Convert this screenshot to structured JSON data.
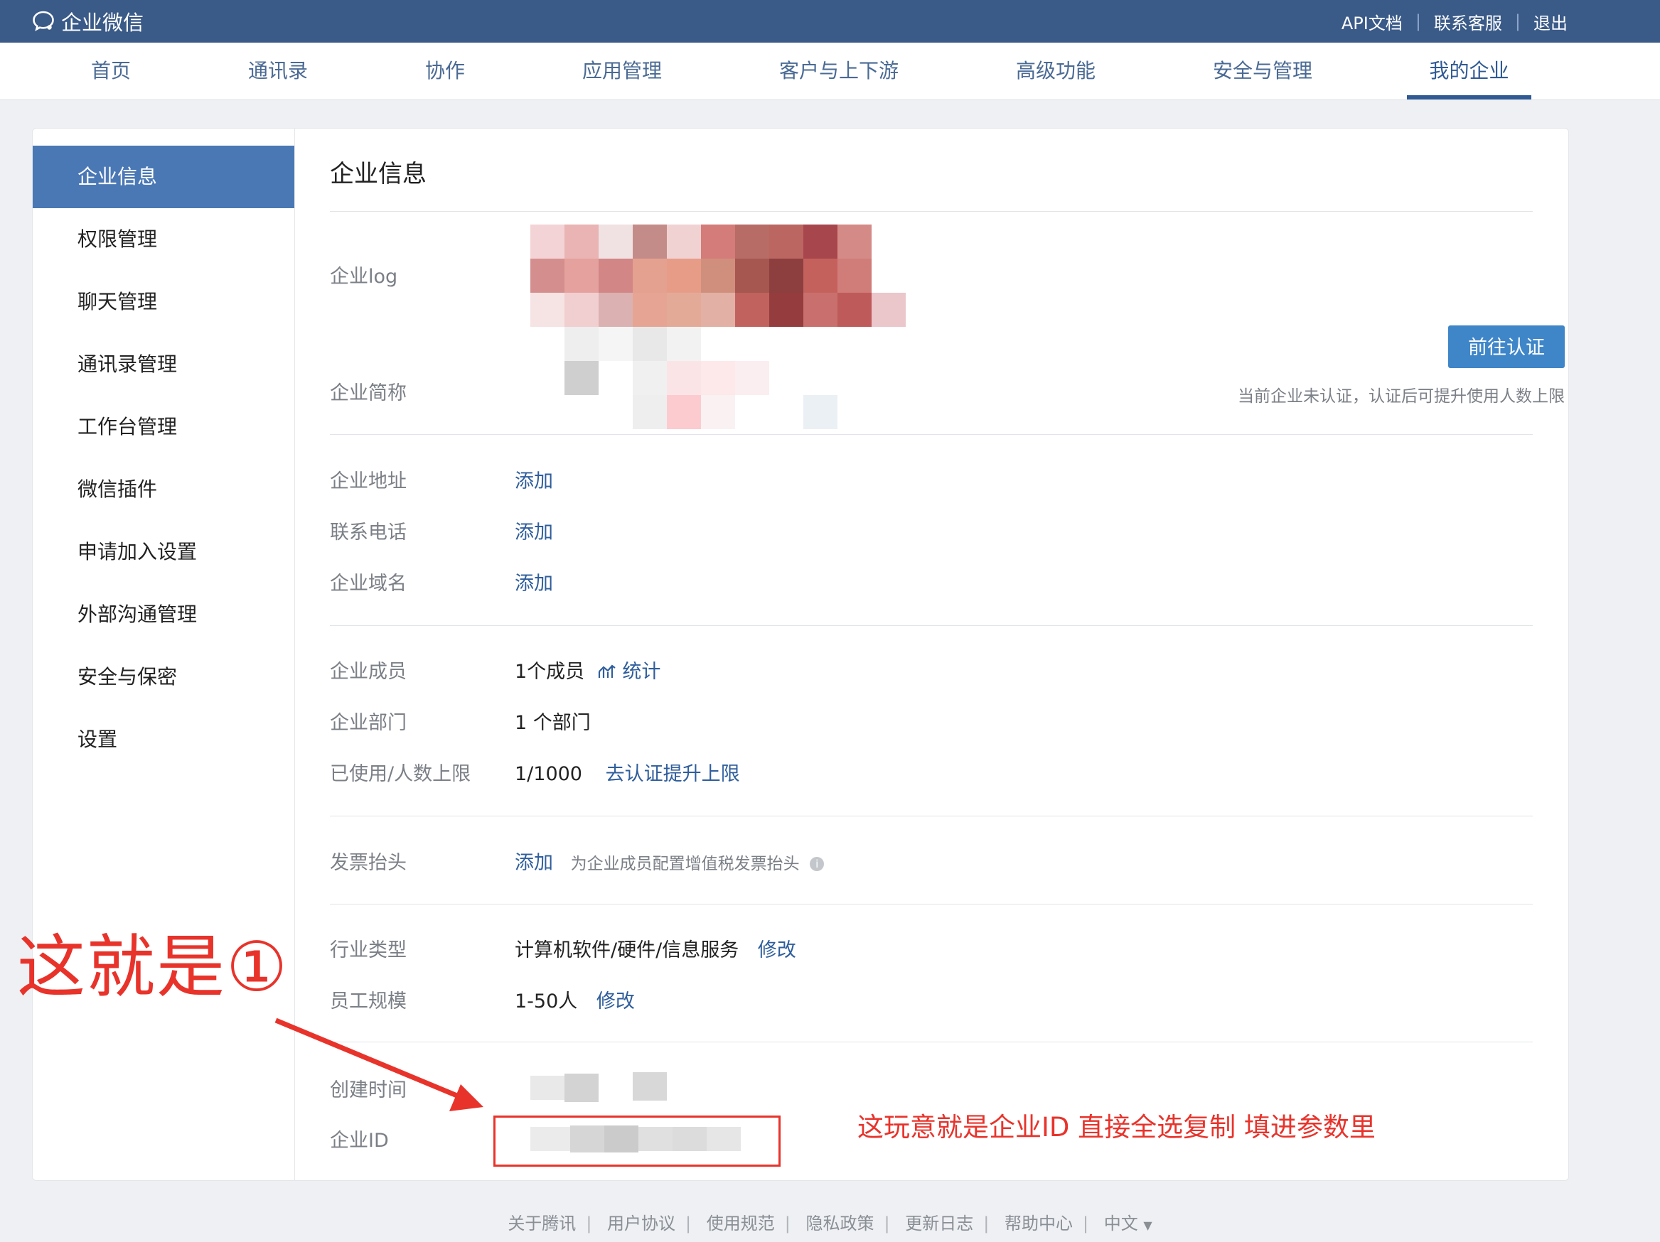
{
  "brand": {
    "name": "企业微信"
  },
  "top_links": [
    "API文档",
    "联系客服",
    "退出"
  ],
  "nav": [
    "首页",
    "通讯录",
    "协作",
    "应用管理",
    "客户与上下游",
    "高级功能",
    "安全与管理",
    "我的企业"
  ],
  "nav_active": "我的企业",
  "sidebar": [
    "企业信息",
    "权限管理",
    "聊天管理",
    "通讯录管理",
    "工作台管理",
    "微信插件",
    "申请加入设置",
    "外部沟通管理",
    "安全与保密",
    "设置"
  ],
  "sidebar_active": "企业信息",
  "page_title": "企业信息",
  "basic": {
    "logo_label": "企业log",
    "short_name_label": "企业简称",
    "certify_button": "前往认证",
    "certify_note": "当前企业未认证，认证后可提升使用人数上限"
  },
  "contact": [
    {
      "label": "企业地址",
      "action": "添加"
    },
    {
      "label": "联系电话",
      "action": "添加"
    },
    {
      "label": "企业域名",
      "action": "添加"
    }
  ],
  "members": {
    "member_label": "企业成员",
    "member_value": "1个成员",
    "stats_link": "统计",
    "dept_label": "企业部门",
    "dept_value": "1 个部门",
    "limit_label": "已使用/人数上限",
    "limit_value": "1/1000",
    "limit_link": "去认证提升上限"
  },
  "invoice": {
    "label": "发票抬头",
    "action": "添加",
    "hint": "为企业成员配置增值税发票抬头"
  },
  "industry": {
    "type_label": "行业类型",
    "type_value": "计算机软件/硬件/信息服务",
    "type_edit": "修改",
    "size_label": "员工规模",
    "size_value": "1-50人",
    "size_edit": "修改"
  },
  "meta": {
    "created_label": "创建时间",
    "id_label": "企业ID"
  },
  "annotations": {
    "big": "这就是①",
    "note": "这玩意就是企业ID 直接全选复制 填进参数里"
  },
  "footer": [
    "关于腾讯",
    "用户协议",
    "使用规范",
    "隐私政策",
    "更新日志",
    "帮助中心"
  ],
  "language": "中文",
  "colors": {
    "header_bg": "#3a5a88",
    "sidebar_active": "#4a78b5",
    "link": "#2f5e9c",
    "button": "#3f86c9",
    "annotation": "#e8332b"
  }
}
